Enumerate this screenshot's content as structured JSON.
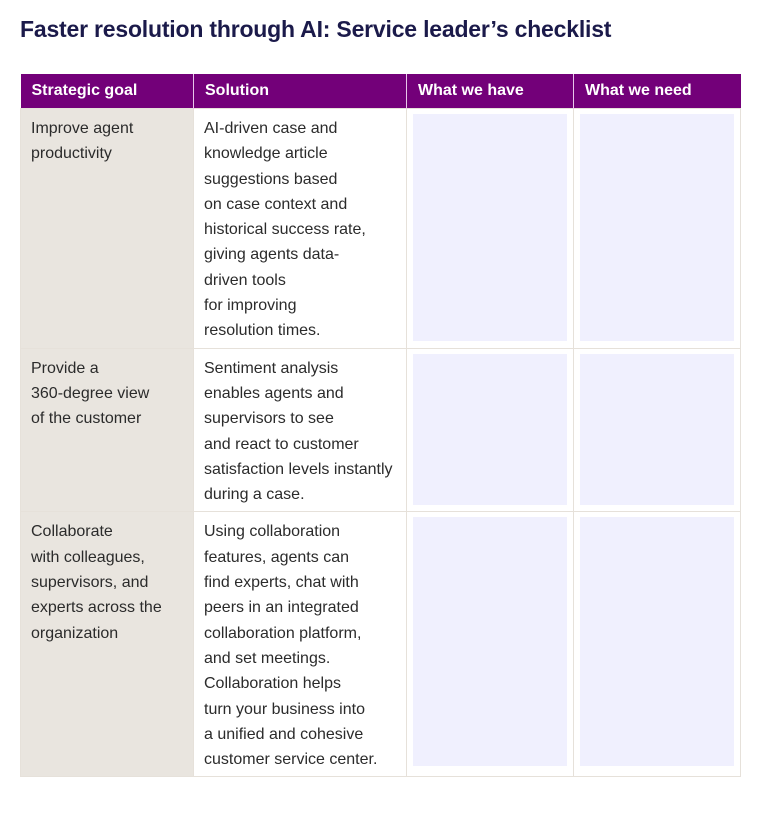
{
  "title": "Faster resolution through AI: Service leader’s checklist",
  "colors": {
    "header_bg": "#730079",
    "goal_bg": "#e9e5df",
    "input_bg": "#f0f0fe",
    "title": "#1b1a4a"
  },
  "table": {
    "headers": [
      "Strategic goal",
      "Solution",
      "What we have",
      "What we need"
    ],
    "rows": [
      {
        "goal": "Improve agent\nproductivity",
        "solution": "AI-driven case and\nknowledge article\nsuggestions based\non case context and\nhistorical success rate,\ngiving agents data-\ndriven tools\nfor improving\nresolution times.",
        "have": "",
        "need": ""
      },
      {
        "goal": "Provide a\n360-degree view\nof the customer",
        "solution": "Sentiment analysis\nenables agents and\nsupervisors to see\nand react to customer\nsatisfaction levels instantly\nduring a case.",
        "have": "",
        "need": ""
      },
      {
        "goal": "Collaborate\nwith colleagues,\nsupervisors, and\nexperts across the\norganization",
        "solution": "Using collaboration\nfeatures, agents can\nfind experts, chat with\npeers in an integrated\ncollaboration platform,\nand set meetings.\nCollaboration helps\nturn your business into\na unified and cohesive\ncustomer service center.",
        "have": "",
        "need": ""
      }
    ]
  }
}
